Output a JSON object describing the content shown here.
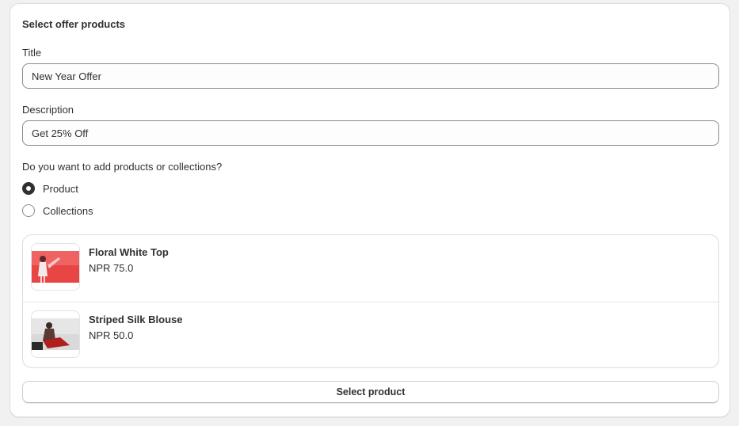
{
  "card": {
    "title": "Select offer products"
  },
  "form": {
    "title_label": "Title",
    "title_value": "New Year Offer",
    "description_label": "Description",
    "description_value": "Get 25% Off",
    "question": "Do you want to add products or collections?",
    "options": [
      {
        "label": "Product",
        "checked": true
      },
      {
        "label": "Collections",
        "checked": false
      }
    ]
  },
  "products": [
    {
      "name": "Floral White Top",
      "price": "NPR 75.0",
      "thumb_icon": "product-photo-red-icon"
    },
    {
      "name": "Striped Silk Blouse",
      "price": "NPR 50.0",
      "thumb_icon": "product-photo-dark-icon"
    }
  ],
  "actions": {
    "select_product_label": "Select product"
  },
  "colors": {
    "text": "#303030",
    "border": "#8a8a8a",
    "background": "#f1f1f1",
    "card": "#ffffff"
  }
}
